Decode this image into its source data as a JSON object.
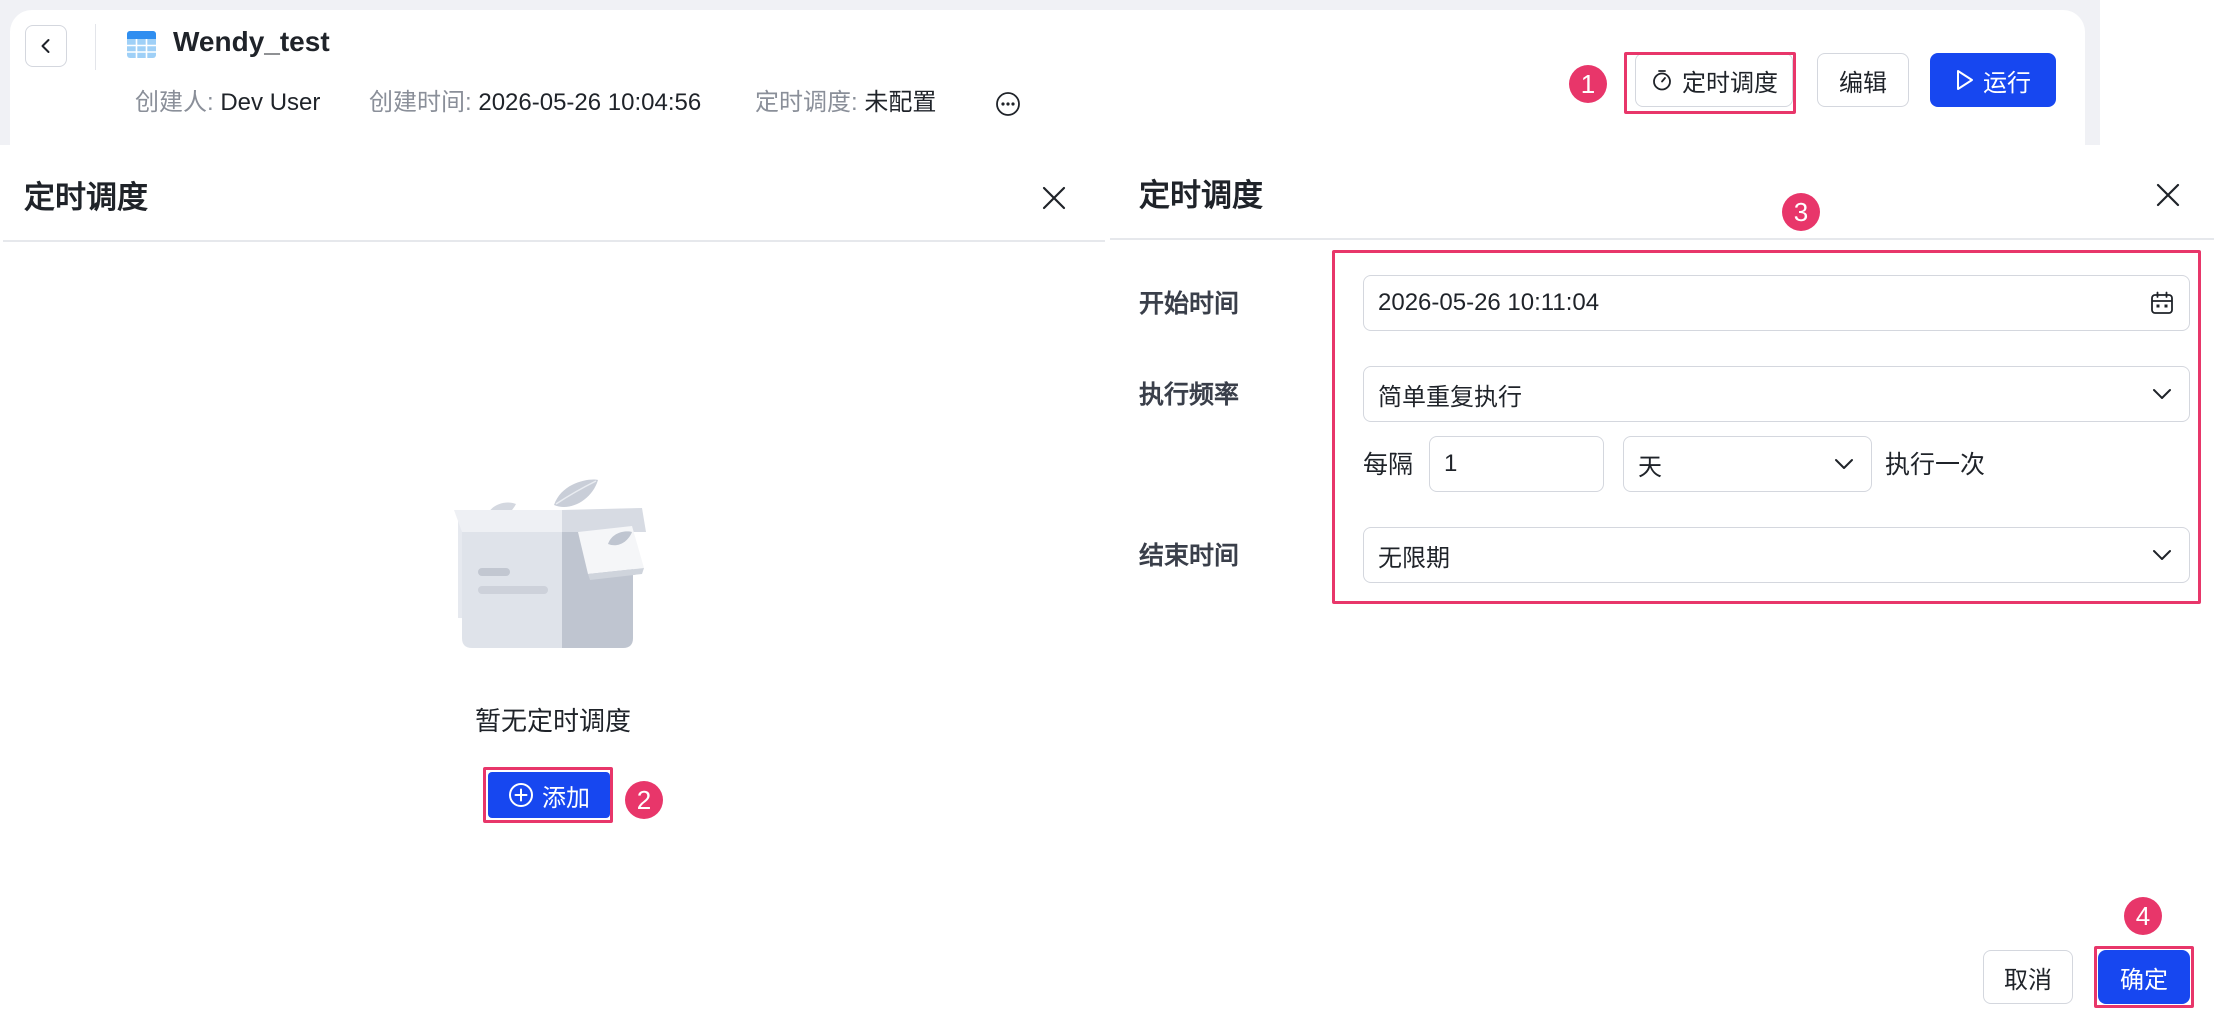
{
  "header": {
    "title": "Wendy_test",
    "creator_label": "创建人:",
    "creator_value": "Dev User",
    "created_label": "创建时间:",
    "created_value": "2026-05-26 10:04:56",
    "schedule_label": "定时调度:",
    "schedule_value": "未配置",
    "schedule_button": "定时调度",
    "edit_button": "编辑",
    "run_button": "运行"
  },
  "left_panel": {
    "title": "定时调度",
    "empty_text": "暂无定时调度",
    "add_button": "添加"
  },
  "right_panel": {
    "title": "定时调度",
    "start_time_label": "开始时间",
    "start_time_value": "2026-05-26 10:11:04",
    "frequency_label": "执行频率",
    "frequency_value": "简单重复执行",
    "every_label": "每隔",
    "interval_value": "1",
    "unit_value": "天",
    "execute_once_label": "执行一次",
    "end_time_label": "结束时间",
    "end_time_value": "无限期",
    "cancel_button": "取消",
    "ok_button": "确定"
  },
  "annotations": [
    "1",
    "2",
    "3",
    "4"
  ],
  "colors": {
    "primary": "#1747f0",
    "highlight": "#e8366a",
    "text": "#1f2329",
    "muted": "#8a8f99"
  },
  "icons": [
    "back-icon",
    "table-icon",
    "more-icon",
    "stopwatch-icon",
    "play-icon",
    "close-icon",
    "plus-circle-icon",
    "calendar-icon",
    "chevron-down-icon",
    "empty-box-illustration"
  ]
}
